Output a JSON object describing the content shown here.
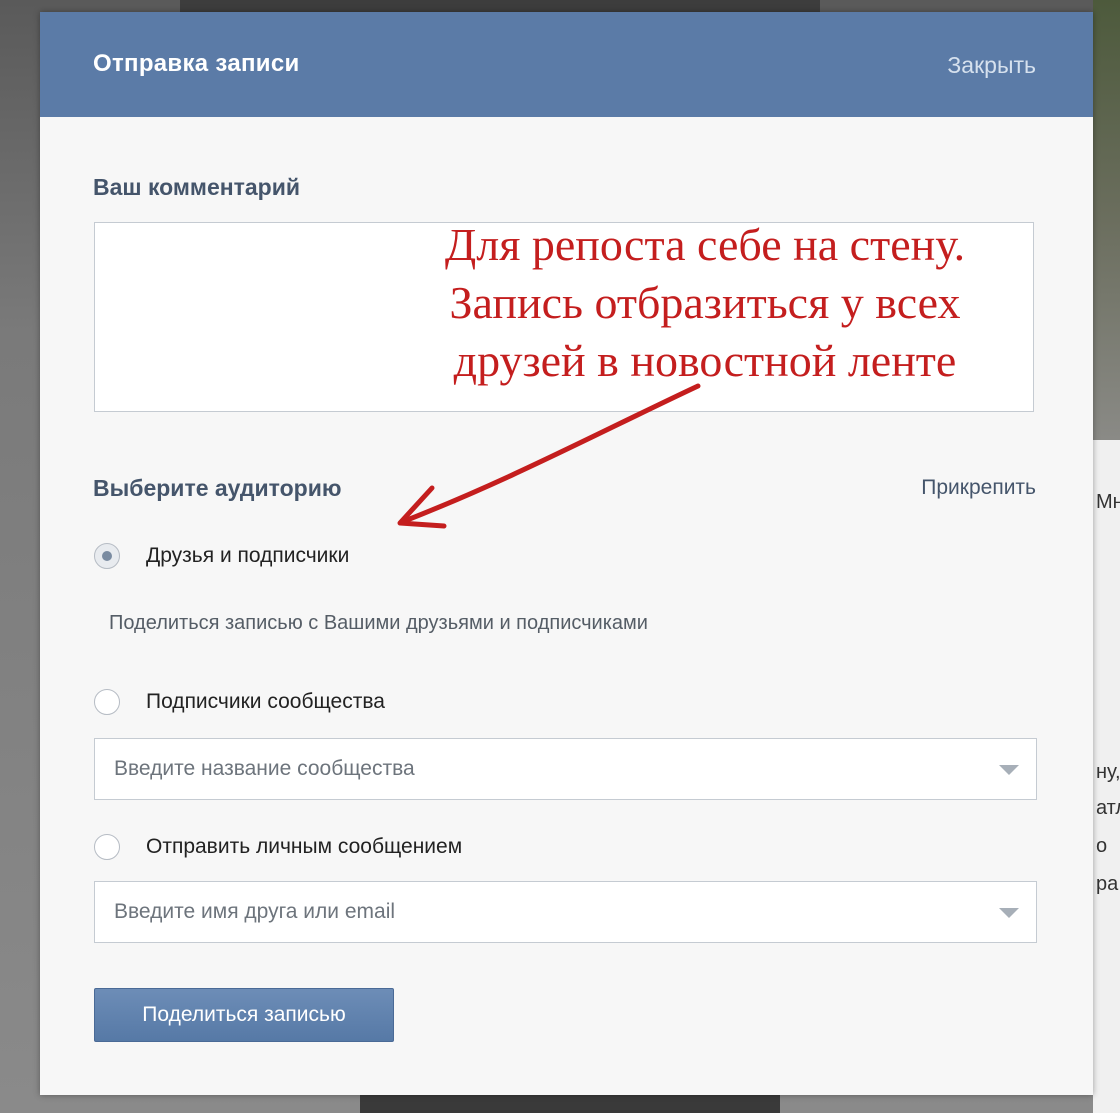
{
  "background": {
    "side_text": [
      "Мн",
      "ну,",
      "атл",
      "о",
      "ра"
    ]
  },
  "modal": {
    "title": "Отправка записи",
    "close_label": "Закрыть"
  },
  "comment": {
    "label": "Ваш комментарий",
    "value": ""
  },
  "annotation": {
    "lines": [
      "Для репоста себе на стену.",
      "Запись отбразиться у всех",
      "друзей в новостной ленте"
    ],
    "color": "#c41e1e"
  },
  "audience": {
    "label": "Выберите аудиторию",
    "attach_label": "Прикрепить",
    "options": [
      {
        "label": "Друзья и подписчики",
        "selected": true
      },
      {
        "label": "Подписчики сообщества",
        "selected": false
      },
      {
        "label": "Отправить личным сообщением",
        "selected": false
      }
    ],
    "friends_hint": "Поделиться записью с Вашими друзьями и подписчиками",
    "community_placeholder": "Введите название сообщества",
    "friend_placeholder": "Введите имя друга или email"
  },
  "share_button": {
    "label": "Поделиться записью"
  },
  "colors": {
    "header": "#5b7ba7",
    "button": "#5f80ac",
    "label_text": "#45556b"
  },
  "icons": {
    "dropdown": "chevron-down-icon",
    "arrow": "red-arrow-annotation"
  }
}
